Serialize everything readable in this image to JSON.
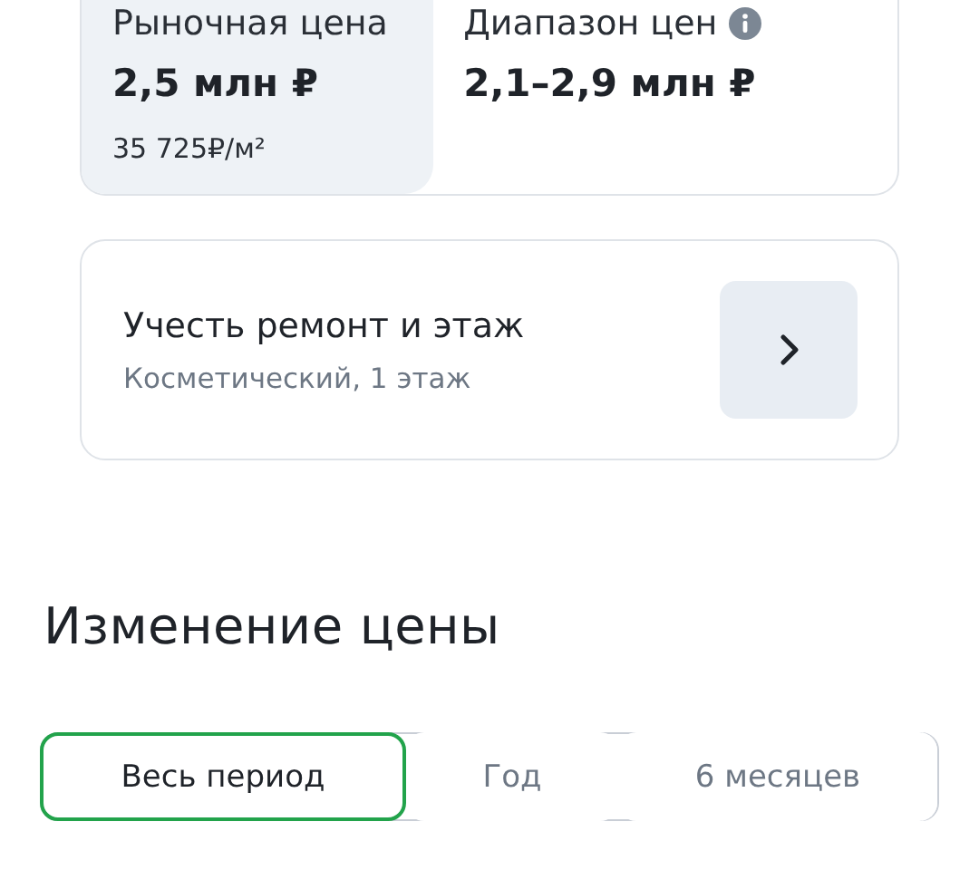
{
  "price_card": {
    "market": {
      "label": "Рыночная цена",
      "value": "2,5 млн ₽",
      "per_meter": "35 725₽/м²"
    },
    "range": {
      "label": "Диапазон цен",
      "value": "2,1–2,9 млн ₽"
    }
  },
  "adjust_card": {
    "title": "Учесть ремонт и этаж",
    "subtitle": "Косметический, 1 этаж"
  },
  "section_title": "Изменение цены",
  "periods": [
    {
      "label": "Весь период",
      "selected": true
    },
    {
      "label": "Год",
      "selected": false
    },
    {
      "label": "6 месяцев",
      "selected": false
    }
  ]
}
